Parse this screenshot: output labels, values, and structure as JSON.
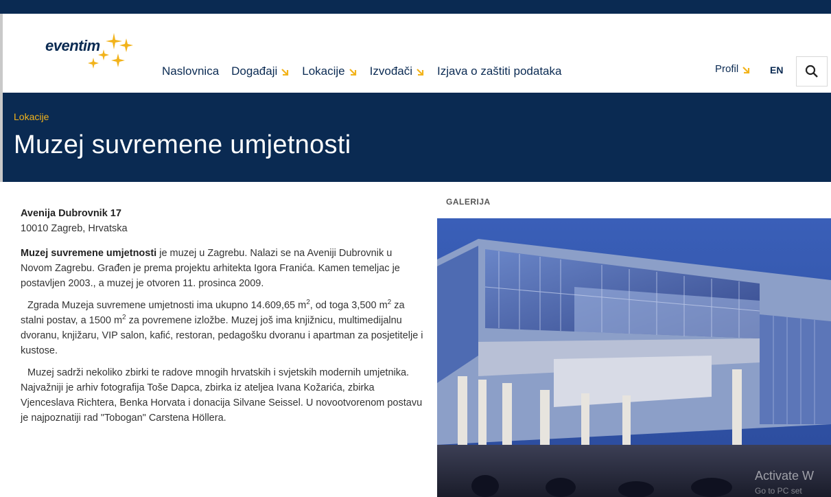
{
  "header": {
    "logo_text": "eventim",
    "nav": [
      {
        "label": "Naslovnica",
        "has_dropdown": false
      },
      {
        "label": "Događaji",
        "has_dropdown": true
      },
      {
        "label": "Lokacije",
        "has_dropdown": true
      },
      {
        "label": "Izvođači",
        "has_dropdown": true
      },
      {
        "label": "Izjava o zaštiti podataka",
        "has_dropdown": false
      }
    ],
    "profile_label": "Profil",
    "lang_label": "EN",
    "search_icon": "search-icon",
    "accent_color": "#f2b31b",
    "brand_color": "#0a2a52"
  },
  "hero": {
    "breadcrumb": "Lokacije",
    "title": "Muzej suvremene umjetnosti"
  },
  "content": {
    "address_line1": "Avenija Dubrovnik 17",
    "address_line2": "10010 Zagreb, Hrvatska",
    "p1_bold": "Muzej suvremene umjetnosti",
    "p1_rest": " je muzej u Zagrebu. Nalazi se na Aveniji Dubrovnik u Novom Zagrebu. Građen je prema projektu arhitekta Igora Franića. Kamen temeljac je postavljen 2003., a muzej je otvoren 11. prosinca 2009.",
    "p2_a": "Zgrada Muzeja suvremene umjetnosti ima ukupno 14.609,65 m",
    "p2_b": ", od toga 3,500 m",
    "p2_c": " za stalni postav, a 1500 m",
    "p2_d": " za povremene izložbe. Muzej još ima knjižnicu, multimedijalnu dvoranu, knjižaru, VIP salon, kafić, restoran, pedagošku dvoranu i apartman za posjetitelje i kustose.",
    "sup2": "2",
    "p3": "Muzej sadrži nekoliko zbirki te radove mnogih hrvatskih i svjetskih modernih umjetnika. Najvažniji je arhiv fotografija Toše Dapca, zbirka iz ateljea Ivana Kožarića, zbirka Vjenceslava Richtera, Benka Horvata i donacija Silvane Seissel. U novootvorenom postavu je najpoznatiji rad \"Tobogan\" Carstena Höllera."
  },
  "gallery": {
    "label": "GALERIJA"
  },
  "os_watermark": {
    "line1": "Activate W",
    "line2": "Go to PC set"
  }
}
